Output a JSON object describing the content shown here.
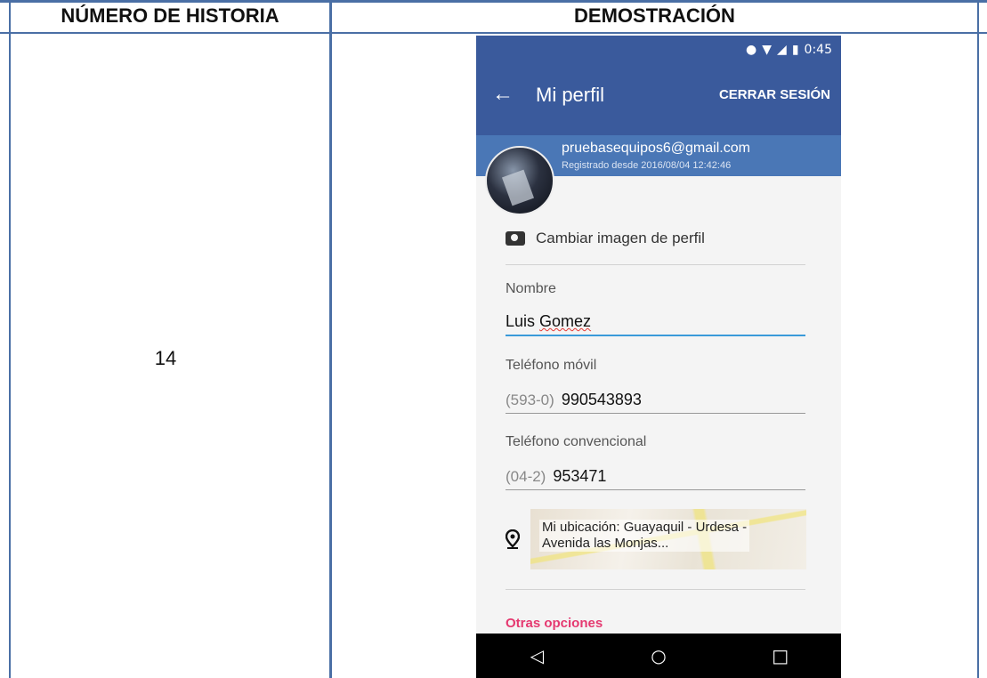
{
  "table": {
    "col1_header": "NÚMERO DE HISTORIA",
    "col2_header": "DEMOSTRACIÓN",
    "story_number": "14"
  },
  "phone": {
    "status_time": "0:45",
    "title": "Mi perfil",
    "logout_label": "CERRAR SESIÓN",
    "email": "pruebasequipos6@gmail.com",
    "registered": "Registrado desde 2016/08/04 12:42:46",
    "change_image_label": "Cambiar imagen de perfil",
    "name_label": "Nombre",
    "name_first": "Luis ",
    "name_last": "Gomez",
    "mobile_label": "Teléfono móvil",
    "mobile_prefix": "(593-0)",
    "mobile_value": "990543893",
    "landline_label": "Teléfono convencional",
    "landline_prefix": "(04-2)",
    "landline_value": "953471",
    "location_line1": "Mi ubicación: Guayaquil - Urdesa -",
    "location_line2": "Avenida las Monjas...",
    "other_options": "Otras opciones",
    "colors": {
      "appbar": "#3a5a9c",
      "accent": "#e53970",
      "field_active": "#3a9ad9"
    },
    "icons": [
      "back-arrow-icon",
      "camera-icon",
      "location-pin-icon",
      "nav-back-icon",
      "nav-home-icon",
      "nav-recents-icon"
    ]
  }
}
